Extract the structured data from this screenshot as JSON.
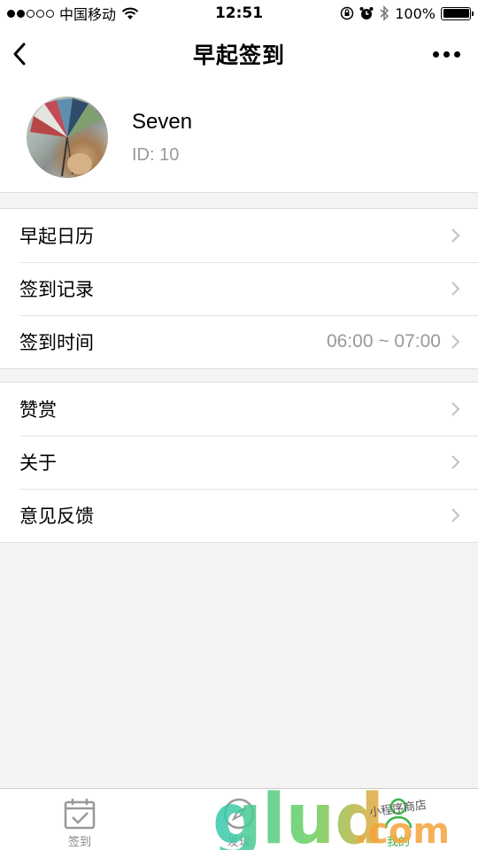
{
  "status_bar": {
    "carrier": "中国移动",
    "time": "12:51",
    "battery": "100%"
  },
  "nav": {
    "title": "早起签到",
    "back_icon": "chevron-left-icon",
    "more_icon": "more-dots-icon"
  },
  "profile": {
    "name": "Seven",
    "id_text": "ID: 10"
  },
  "menu_group_1": [
    {
      "label": "早起日历",
      "value": ""
    },
    {
      "label": "签到记录",
      "value": ""
    },
    {
      "label": "签到时间",
      "value": "06:00 ~ 07:00"
    }
  ],
  "menu_group_2": [
    {
      "label": "赞赏",
      "value": ""
    },
    {
      "label": "关于",
      "value": ""
    },
    {
      "label": "意见反馈",
      "value": ""
    }
  ],
  "tabs": [
    {
      "label": "签到",
      "icon": "calendar-check-icon",
      "active": false
    },
    {
      "label": "发现",
      "icon": "compass-icon",
      "active": false
    },
    {
      "label": "我的",
      "icon": "person-icon",
      "active": true
    }
  ],
  "watermark": {
    "text": "glud.com",
    "subtext": "小程序商店"
  },
  "colors": {
    "accent": "#3ab54a",
    "background": "#f4f4f4",
    "muted_text": "#999999"
  }
}
